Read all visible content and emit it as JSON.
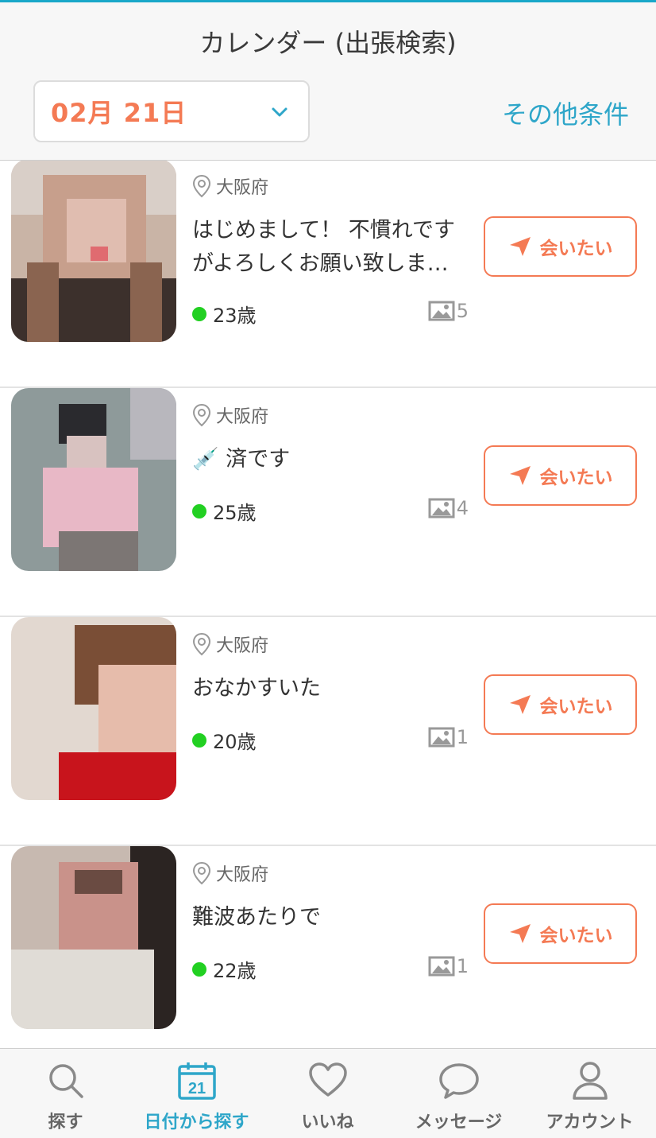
{
  "header": {
    "title": "カレンダー (出張検索)",
    "date_value": "02月 21日",
    "other_conditions": "その他条件"
  },
  "colors": {
    "accent": "#2ea6c9",
    "brand_orange": "#f47a54",
    "online": "#22d022"
  },
  "profiles": [
    {
      "location": "大阪府",
      "message_line1": "はじめまして！ 不慣れです",
      "message_line2": "がよろしくお願い致しま…",
      "age": "23歳",
      "photo_count": "5",
      "button": "会いたい"
    },
    {
      "location": "大阪府",
      "message_line1": "💉 済です",
      "message_line2": "",
      "age": "25歳",
      "photo_count": "4",
      "button": "会いたい"
    },
    {
      "location": "大阪府",
      "message_line1": "おなかすいた",
      "message_line2": "",
      "age": "20歳",
      "photo_count": "1",
      "button": "会いたい"
    },
    {
      "location": "大阪府",
      "message_line1": "難波あたりで",
      "message_line2": "",
      "age": "22歳",
      "photo_count": "1",
      "button": "会いたい"
    }
  ],
  "tabs": [
    {
      "label": "探す",
      "icon": "search-icon",
      "active": false
    },
    {
      "label": "日付から探す",
      "icon": "calendar-icon",
      "active": true,
      "calendar_day": "21"
    },
    {
      "label": "いいね",
      "icon": "heart-icon",
      "active": false
    },
    {
      "label": "メッセージ",
      "icon": "chat-bubble-icon",
      "active": false
    },
    {
      "label": "アカウント",
      "icon": "person-icon",
      "active": false
    }
  ]
}
